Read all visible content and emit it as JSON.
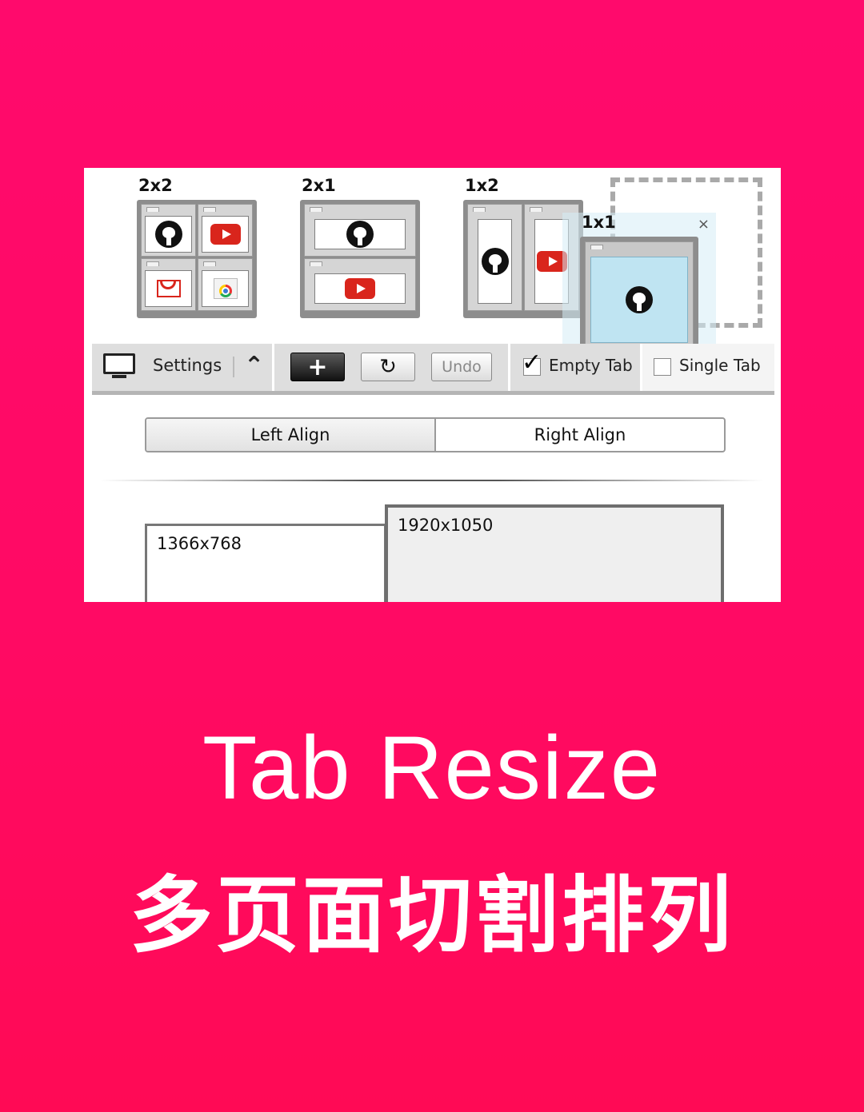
{
  "layouts": [
    {
      "label": "2x2"
    },
    {
      "label": "2x1"
    },
    {
      "label": "1x2"
    }
  ],
  "drag_preview": {
    "label": "1x1",
    "close": "×"
  },
  "toolbar": {
    "settings_label": "Settings",
    "add_symbol": "+",
    "refresh_symbol": "↻",
    "undo_label": "Undo",
    "checkmark": "✓",
    "empty_tab_label": "Empty Tab",
    "single_tab_label": "Single Tab",
    "collapse_symbol": "⌃"
  },
  "alignment": {
    "left_label": "Left Align",
    "right_label": "Right Align"
  },
  "screens": [
    {
      "label": "1366x768"
    },
    {
      "label": "1920x1050"
    }
  ],
  "headline": {
    "en": "Tab Resize",
    "zh": "多页面切割排列"
  },
  "colors": {
    "background": "#ff0a64",
    "panel": "#ffffff",
    "preview_fill": "#bfe4f2"
  }
}
